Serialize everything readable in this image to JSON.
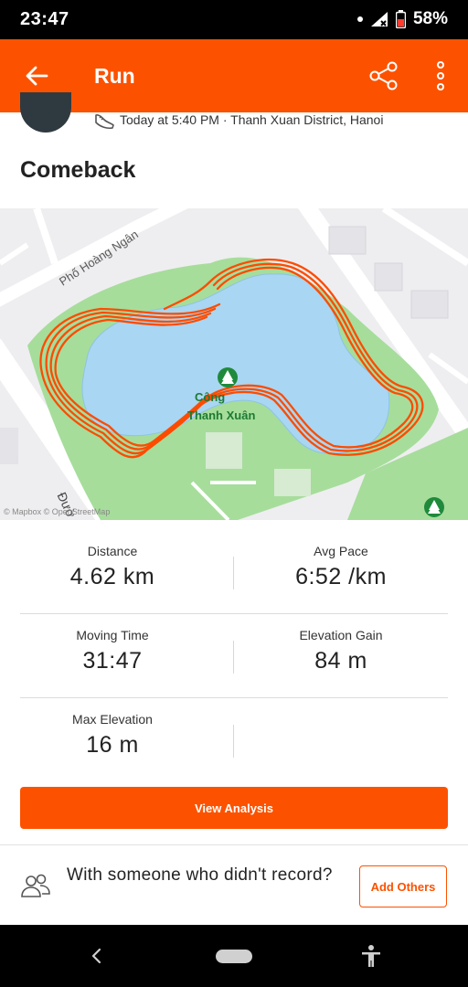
{
  "status_bar": {
    "time": "23:47",
    "battery": "58%"
  },
  "app_bar": {
    "title": "Run",
    "icons": [
      "back-arrow-icon",
      "share-icon",
      "more-vertical-icon"
    ]
  },
  "activity": {
    "meta": "Today at 5:40 PM · Thanh Xuan District, Hanoi",
    "title": "Comeback"
  },
  "map": {
    "street_label_1": "Phố Hoàng Ngân",
    "street_label_2": "Đườ",
    "park_label_line1": "Công",
    "park_label_line2": "Thanh Xuân",
    "credit": "© Mapbox © OpenStreetMap",
    "colors": {
      "route": "#fc4c02",
      "water": "#a9d6f2",
      "park": "#a6dd9b",
      "road": "#ffffff",
      "land": "#eeeef0"
    }
  },
  "stats": {
    "distance": {
      "label": "Distance",
      "value": "4.62 km"
    },
    "avg_pace": {
      "label": "Avg Pace",
      "value": "6:52 /km"
    },
    "moving_time": {
      "label": "Moving Time",
      "value": "31:47"
    },
    "elevation_gain": {
      "label": "Elevation Gain",
      "value": "84 m"
    },
    "max_elevation": {
      "label": "Max Elevation",
      "value": "16 m"
    }
  },
  "actions": {
    "view_analysis": "View Analysis",
    "with_someone": "With someone who didn't record?",
    "add_others": "Add Others"
  },
  "accent_color": "#fc5200"
}
